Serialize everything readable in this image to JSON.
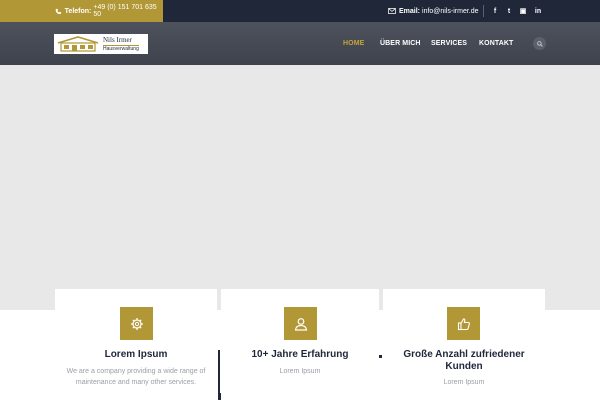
{
  "topbar": {
    "phone_label": "Telefon:",
    "phone_value": "+49 (0) 151 701 635 50",
    "email_label": "Email:",
    "email_value": "info@nils-irmer.de",
    "social": [
      {
        "icon": "facebook-icon",
        "glyph": "f"
      },
      {
        "icon": "twitter-icon",
        "glyph": "t"
      },
      {
        "icon": "flickr-icon",
        "glyph": "▣"
      },
      {
        "icon": "linkedin-icon",
        "glyph": "in"
      }
    ]
  },
  "logo": {
    "name": "Nils Irmer",
    "subtitle": "Hausverwaltung"
  },
  "nav": {
    "items": [
      {
        "label": "HOME",
        "active": true
      },
      {
        "label": "ÜBER MICH",
        "active": false
      },
      {
        "label": "SERVICES",
        "active": false
      },
      {
        "label": "KONTAKT",
        "active": false
      }
    ],
    "search_icon": "search-icon"
  },
  "features": [
    {
      "icon": "gear-icon",
      "title": "Lorem Ipsum",
      "text_lines": [
        "We are a company providing a wide range of",
        "maintenance and many other services."
      ]
    },
    {
      "icon": "user-icon",
      "title": "10+ Jahre Erfahrung",
      "text_lines": [
        "Lorem Ipsum"
      ]
    },
    {
      "icon": "thumbs-up-icon",
      "title_lines": [
        "Große Anzahl zufriedener",
        "Kunden"
      ],
      "text_lines": [
        "Lorem Ipsum"
      ]
    }
  ],
  "colors": {
    "gold": "#b29736",
    "navy": "#1f2738",
    "nav_bg": "#464a54",
    "hero_bg": "#e8e8e8"
  }
}
